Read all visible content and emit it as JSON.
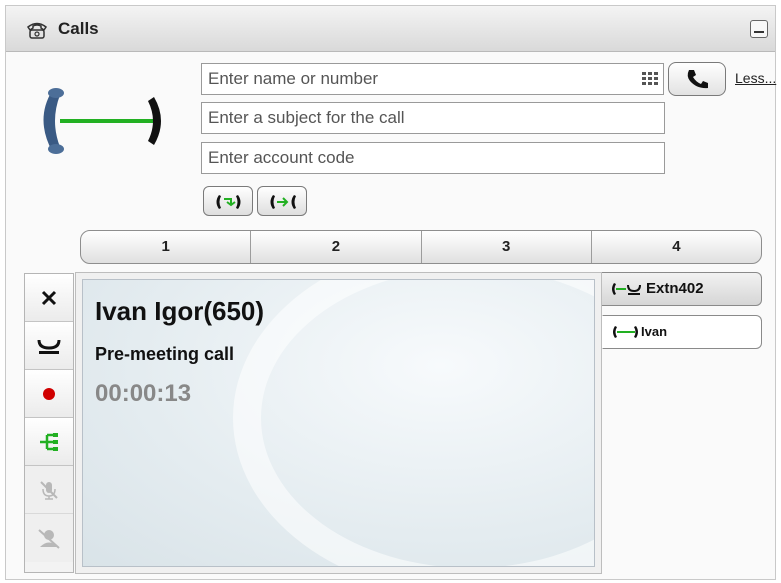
{
  "window": {
    "title": "Calls"
  },
  "inputs": {
    "name_placeholder": "Enter name or number",
    "subject_placeholder": "Enter a subject for the call",
    "account_placeholder": "Enter account code"
  },
  "links": {
    "less": "Less..."
  },
  "tabs": [
    {
      "label": "1"
    },
    {
      "label": "2"
    },
    {
      "label": "3"
    },
    {
      "label": "4"
    }
  ],
  "call": {
    "name": "Ivan Igor(650)",
    "subject": "Pre-meeting call",
    "duration": "00:00:13"
  },
  "side_calls": [
    {
      "label": "Extn402",
      "state": "held"
    },
    {
      "label": "Ivan",
      "state": "connected"
    }
  ],
  "colors": {
    "connected_green": "#22b022",
    "record_red": "#d00000",
    "handset_blue": "#3a5a84"
  },
  "icons": [
    "phone-icon",
    "dialpad-icon",
    "call-icon",
    "transfer-icon",
    "conference-icon",
    "drop-icon",
    "hold-icon",
    "record-icon",
    "park-icon",
    "mute-icon",
    "headset-icon"
  ]
}
